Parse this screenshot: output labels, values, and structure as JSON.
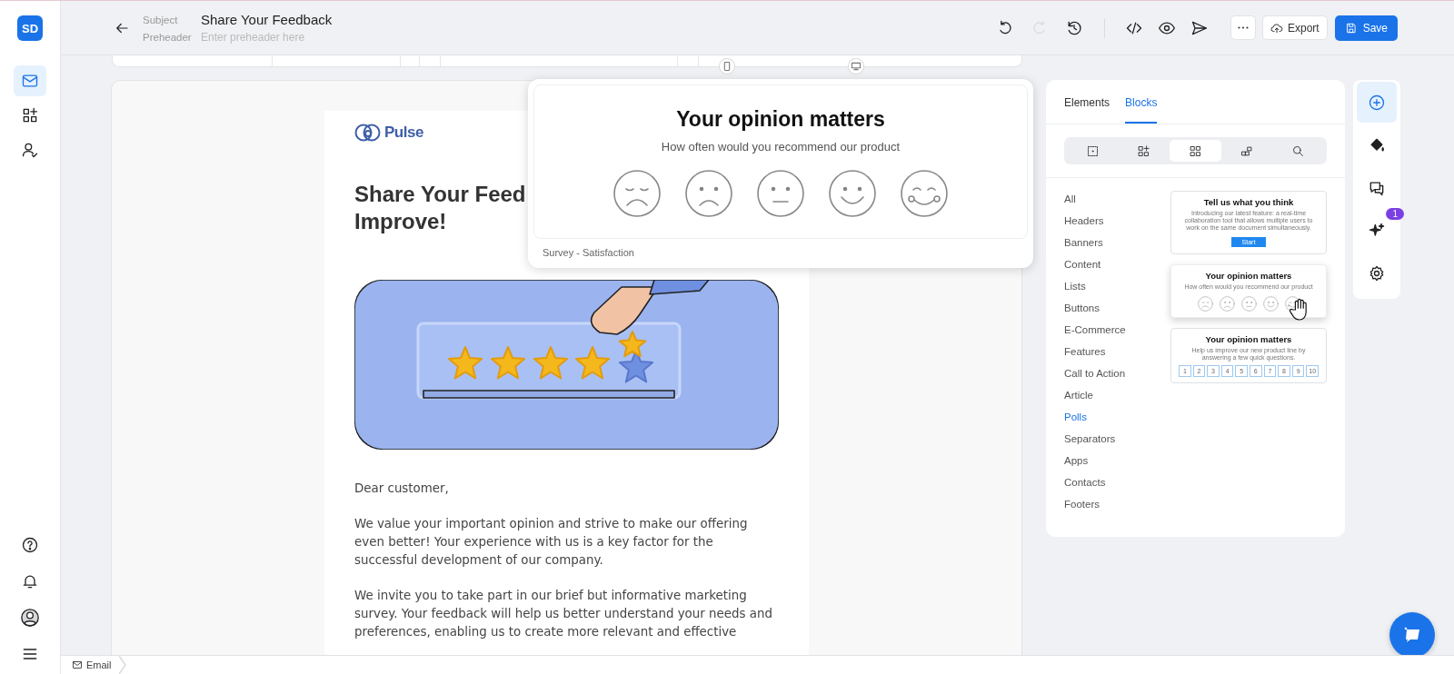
{
  "nav": {
    "logo": "SD",
    "items": [
      {
        "selected": true
      },
      {
        "selected": false
      },
      {
        "selected": false
      }
    ]
  },
  "top_bar": {
    "subject_label": "Subject",
    "title": "Share Your Feedback",
    "preheader_label": "Preheader",
    "preheader_placeholder": "Enter preheader here",
    "history_tools": [
      {
        "disabled": false
      },
      {
        "disabled": true
      },
      {
        "disabled": false
      }
    ],
    "export": "Export",
    "save": "Save"
  },
  "email": {
    "logo": "Pulse",
    "heading_lines": [
      "Share Your Feed",
      "Improve!"
    ],
    "greeting": "Dear customer,",
    "paragraphs": [
      "We value your important opinion and strive to make our offering even better! Your experience with us is a key factor for the successful development of our company.",
      "We invite you to take part in our brief but informative marketing survey. Your feedback will help us better understand your needs and preferences, enabling us to create more relevant and effective"
    ]
  },
  "preview": {
    "title": "Your opinion matters",
    "subtitle": "How often would you recommend our product",
    "caption": "Survey - Satisfaction"
  },
  "panel": {
    "tabs": [
      {
        "label": "Elements",
        "selected": false
      },
      {
        "label": "Blocks",
        "selected": true
      }
    ],
    "filters": [
      {
        "selected": false
      },
      {
        "selected": false
      },
      {
        "selected": true
      },
      {
        "selected": false
      },
      {
        "selected": false
      }
    ],
    "categories": [
      {
        "label": "All",
        "selected": false
      },
      {
        "label": "Headers",
        "selected": false
      },
      {
        "label": "Banners",
        "selected": false
      },
      {
        "label": "Content",
        "selected": false
      },
      {
        "label": "Lists",
        "selected": false
      },
      {
        "label": "Buttons",
        "selected": false
      },
      {
        "label": "E-Commerce",
        "selected": false
      },
      {
        "label": "Features",
        "selected": false
      },
      {
        "label": "Call to Action",
        "selected": false
      },
      {
        "label": "Article",
        "selected": false
      },
      {
        "label": "Polls",
        "selected": true
      },
      {
        "label": "Separators",
        "selected": false
      },
      {
        "label": "Apps",
        "selected": false
      },
      {
        "label": "Contacts",
        "selected": false
      },
      {
        "label": "Footers",
        "selected": false
      }
    ],
    "blocks": [
      {
        "kind": "button",
        "title": "Tell us what you think",
        "text": "Introducing our latest feature: a real-time collaboration tool that allows multiple users to work on the same document simultaneously.",
        "button": "Start",
        "hovered": false
      },
      {
        "kind": "faces",
        "title": "Your opinion matters",
        "text": "How often would you recommend our product",
        "hovered": true
      },
      {
        "kind": "scale",
        "title": "Your opinion matters",
        "text": "Help us improve our new product line by answering a few quick questions.",
        "numbers": [
          "1",
          "2",
          "3",
          "4",
          "5",
          "6",
          "7",
          "8",
          "9",
          "10"
        ],
        "hovered": false
      }
    ]
  },
  "side_tools": [
    {
      "selected": true
    },
    {
      "selected": false
    },
    {
      "selected": false
    },
    {
      "selected": false,
      "badge": "1"
    },
    {
      "selected": false
    }
  ],
  "status_bar": {
    "crumb": "Email"
  }
}
